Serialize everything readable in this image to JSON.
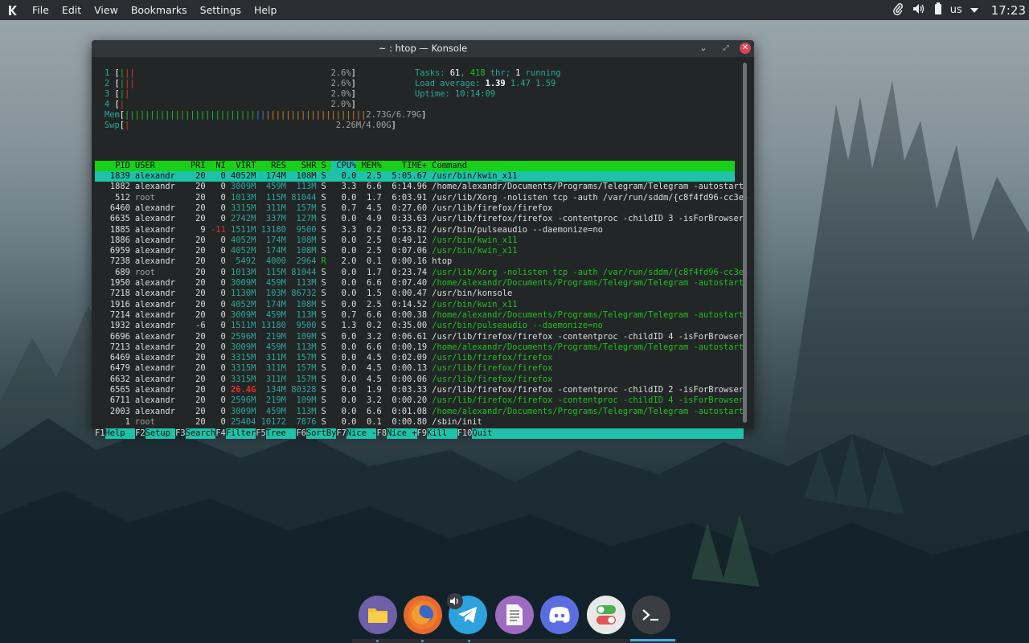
{
  "panel": {
    "menu": [
      "File",
      "Edit",
      "View",
      "Bookmarks",
      "Settings",
      "Help"
    ],
    "lang": "us",
    "clock": "17:23"
  },
  "window": {
    "title": "~ : htop — Konsole"
  },
  "htop": {
    "cpus": [
      {
        "num": "1",
        "percent": "2.6%"
      },
      {
        "num": "2",
        "percent": "2.6%"
      },
      {
        "num": "3",
        "percent": "2.0%"
      },
      {
        "num": "4",
        "percent": "2.0%"
      }
    ],
    "mem": {
      "label": "Mem",
      "value": "2.73G/6.79G"
    },
    "swp": {
      "label": "Swp",
      "value": "2.26M/4.00G"
    },
    "tasks_label": "Tasks: ",
    "tasks_count": "61",
    "tasks_sep": ", ",
    "thr_count": "418",
    "thr_label": " thr; ",
    "running_count": "1",
    "running_label": " running",
    "load_label": "Load average: ",
    "load1": "1.39",
    "load5": "1.47",
    "load15": "1.59",
    "uptime_label": "Uptime: ",
    "uptime": "10:14:09",
    "columns": [
      "PID",
      "USER",
      "PRI",
      "NI",
      "VIRT",
      "RES",
      "SHR",
      "S",
      "CPU%",
      "MEM%",
      "TIME+",
      "Command"
    ],
    "processes": [
      {
        "pid": "1839",
        "user": "alexandr",
        "pri": "20",
        "ni": "0",
        "virt": "4052M",
        "res": "174M",
        "shr": "108M",
        "s": "S",
        "cpu": "0.0",
        "mem": "2.5",
        "time": "5:05.67",
        "cmd": "/usr/bin/kwin_x11",
        "sel": true
      },
      {
        "pid": "1882",
        "user": "alexandr",
        "pri": "20",
        "ni": "0",
        "virt": "3009M",
        "res": "459M",
        "shr": "113M",
        "s": "S",
        "cpu": "3.3",
        "mem": "6.6",
        "time": "6:14.96",
        "cmd": "/home/alexandr/Documents/Programs/Telegram/Telegram -autostart"
      },
      {
        "pid": "512",
        "user": "root",
        "pri": "20",
        "ni": "0",
        "virt": "1013M",
        "res": "115M",
        "shr": "81044",
        "s": "S",
        "cpu": "0.0",
        "mem": "1.7",
        "time": "6:03.91",
        "cmd": "/usr/lib/Xorg -nolisten tcp -auth /var/run/sddm/{c8f4fd96-cc3e-"
      },
      {
        "pid": "6460",
        "user": "alexandr",
        "pri": "20",
        "ni": "0",
        "virt": "3315M",
        "res": "311M",
        "shr": "157M",
        "s": "S",
        "cpu": "0.7",
        "mem": "4.5",
        "time": "0:27.60",
        "cmd": "/usr/lib/firefox/firefox"
      },
      {
        "pid": "6635",
        "user": "alexandr",
        "pri": "20",
        "ni": "0",
        "virt": "2742M",
        "res": "337M",
        "shr": "127M",
        "s": "S",
        "cpu": "0.0",
        "mem": "4.9",
        "time": "0:33.63",
        "cmd": "/usr/lib/firefox/firefox -contentproc -childID 3 -isForBrowser"
      },
      {
        "pid": "1885",
        "user": "alexandr",
        "pri": "9",
        "ni": "-11",
        "virt": "1511M",
        "res": "13180",
        "shr": "9500",
        "s": "S",
        "cpu": "3.3",
        "mem": "0.2",
        "time": "0:53.82",
        "cmd": "/usr/bin/pulseaudio --daemonize=no"
      },
      {
        "pid": "1886",
        "user": "alexandr",
        "pri": "20",
        "ni": "0",
        "virt": "4052M",
        "res": "174M",
        "shr": "108M",
        "s": "S",
        "cpu": "0.0",
        "mem": "2.5",
        "time": "0:49.12",
        "cmd": "/usr/bin/kwin_x11",
        "thread": true
      },
      {
        "pid": "6959",
        "user": "alexandr",
        "pri": "20",
        "ni": "0",
        "virt": "4052M",
        "res": "174M",
        "shr": "108M",
        "s": "S",
        "cpu": "0.0",
        "mem": "2.5",
        "time": "0:07.06",
        "cmd": "/usr/bin/kwin_x11",
        "thread": true
      },
      {
        "pid": "7238",
        "user": "alexandr",
        "pri": "20",
        "ni": "0",
        "virt": "5492",
        "res": "4000",
        "shr": "2964",
        "s": "R",
        "cpu": "2.0",
        "mem": "0.1",
        "time": "0:00.16",
        "cmd": "htop"
      },
      {
        "pid": "689",
        "user": "root",
        "pri": "20",
        "ni": "0",
        "virt": "1013M",
        "res": "115M",
        "shr": "81044",
        "s": "S",
        "cpu": "0.0",
        "mem": "1.7",
        "time": "0:23.74",
        "cmd": "/usr/lib/Xorg -nolisten tcp -auth /var/run/sddm/{c8f4fd96-cc3e-",
        "thread": true
      },
      {
        "pid": "1950",
        "user": "alexandr",
        "pri": "20",
        "ni": "0",
        "virt": "3009M",
        "res": "459M",
        "shr": "113M",
        "s": "S",
        "cpu": "0.0",
        "mem": "6.6",
        "time": "0:07.40",
        "cmd": "/home/alexandr/Documents/Programs/Telegram/Telegram -autostart",
        "thread": true
      },
      {
        "pid": "7218",
        "user": "alexandr",
        "pri": "20",
        "ni": "0",
        "virt": "1130M",
        "res": "103M",
        "shr": "86732",
        "s": "S",
        "cpu": "0.0",
        "mem": "1.5",
        "time": "0:00.47",
        "cmd": "/usr/bin/konsole"
      },
      {
        "pid": "1916",
        "user": "alexandr",
        "pri": "20",
        "ni": "0",
        "virt": "4052M",
        "res": "174M",
        "shr": "108M",
        "s": "S",
        "cpu": "0.0",
        "mem": "2.5",
        "time": "0:14.52",
        "cmd": "/usr/bin/kwin_x11",
        "thread": true
      },
      {
        "pid": "7214",
        "user": "alexandr",
        "pri": "20",
        "ni": "0",
        "virt": "3009M",
        "res": "459M",
        "shr": "113M",
        "s": "S",
        "cpu": "0.7",
        "mem": "6.6",
        "time": "0:00.38",
        "cmd": "/home/alexandr/Documents/Programs/Telegram/Telegram -autostart",
        "thread": true
      },
      {
        "pid": "1932",
        "user": "alexandr",
        "pri": "-6",
        "ni": "0",
        "virt": "1511M",
        "res": "13180",
        "shr": "9500",
        "s": "S",
        "cpu": "1.3",
        "mem": "0.2",
        "time": "0:35.00",
        "cmd": "/usr/bin/pulseaudio --daemonize=no",
        "thread": true
      },
      {
        "pid": "6696",
        "user": "alexandr",
        "pri": "20",
        "ni": "0",
        "virt": "2596M",
        "res": "219M",
        "shr": "109M",
        "s": "S",
        "cpu": "0.0",
        "mem": "3.2",
        "time": "0:06.61",
        "cmd": "/usr/lib/firefox/firefox -contentproc -childID 4 -isForBrowser"
      },
      {
        "pid": "7213",
        "user": "alexandr",
        "pri": "20",
        "ni": "0",
        "virt": "3009M",
        "res": "459M",
        "shr": "113M",
        "s": "S",
        "cpu": "0.0",
        "mem": "6.6",
        "time": "0:00.19",
        "cmd": "/home/alexandr/Documents/Programs/Telegram/Telegram -autostart",
        "thread": true
      },
      {
        "pid": "6469",
        "user": "alexandr",
        "pri": "20",
        "ni": "0",
        "virt": "3315M",
        "res": "311M",
        "shr": "157M",
        "s": "S",
        "cpu": "0.0",
        "mem": "4.5",
        "time": "0:02.09",
        "cmd": "/usr/lib/firefox/firefox",
        "thread": true
      },
      {
        "pid": "6479",
        "user": "alexandr",
        "pri": "20",
        "ni": "0",
        "virt": "3315M",
        "res": "311M",
        "shr": "157M",
        "s": "S",
        "cpu": "0.0",
        "mem": "4.5",
        "time": "0:00.13",
        "cmd": "/usr/lib/firefox/firefox",
        "thread": true
      },
      {
        "pid": "6632",
        "user": "alexandr",
        "pri": "20",
        "ni": "0",
        "virt": "3315M",
        "res": "311M",
        "shr": "157M",
        "s": "S",
        "cpu": "0.0",
        "mem": "4.5",
        "time": "0:00.06",
        "cmd": "/usr/lib/firefox/firefox",
        "thread": true
      },
      {
        "pid": "6565",
        "user": "alexandr",
        "pri": "20",
        "ni": "0",
        "virt": "26.4G",
        "res": "134M",
        "shr": "80328",
        "s": "S",
        "cpu": "0.0",
        "mem": "1.9",
        "time": "0:03.33",
        "cmd": "/usr/lib/firefox/firefox -contentproc -childID 2 -isForBrowser",
        "bigvirt": true
      },
      {
        "pid": "6711",
        "user": "alexandr",
        "pri": "20",
        "ni": "0",
        "virt": "2596M",
        "res": "219M",
        "shr": "109M",
        "s": "S",
        "cpu": "0.0",
        "mem": "3.2",
        "time": "0:00.20",
        "cmd": "/usr/lib/firefox/firefox -contentproc -childID 4 -isForBrowser",
        "thread": true
      },
      {
        "pid": "2003",
        "user": "alexandr",
        "pri": "20",
        "ni": "0",
        "virt": "3009M",
        "res": "459M",
        "shr": "113M",
        "s": "S",
        "cpu": "0.0",
        "mem": "6.6",
        "time": "0:01.08",
        "cmd": "/home/alexandr/Documents/Programs/Telegram/Telegram -autostart",
        "thread": true
      },
      {
        "pid": "1",
        "user": "root",
        "pri": "20",
        "ni": "0",
        "virt": "25404",
        "res": "10172",
        "shr": "7876",
        "s": "S",
        "cpu": "0.0",
        "mem": "0.1",
        "time": "0:00.80",
        "cmd": "/sbin/init"
      }
    ],
    "fkeys": [
      {
        "key": "F1",
        "label": "Help  "
      },
      {
        "key": "F2",
        "label": "Setup "
      },
      {
        "key": "F3",
        "label": "Search"
      },
      {
        "key": "F4",
        "label": "Filter"
      },
      {
        "key": "F5",
        "label": "Tree  "
      },
      {
        "key": "F6",
        "label": "SortBy"
      },
      {
        "key": "F7",
        "label": "Nice -"
      },
      {
        "key": "F8",
        "label": "Nice +"
      },
      {
        "key": "F9",
        "label": "Kill  "
      },
      {
        "key": "F10",
        "label": "Quit  "
      }
    ]
  },
  "dock": {
    "apps": [
      "file-manager-icon",
      "firefox-icon",
      "telegram-icon",
      "text-editor-icon",
      "discord-icon",
      "settings-toggle-icon",
      "terminal-icon"
    ]
  }
}
